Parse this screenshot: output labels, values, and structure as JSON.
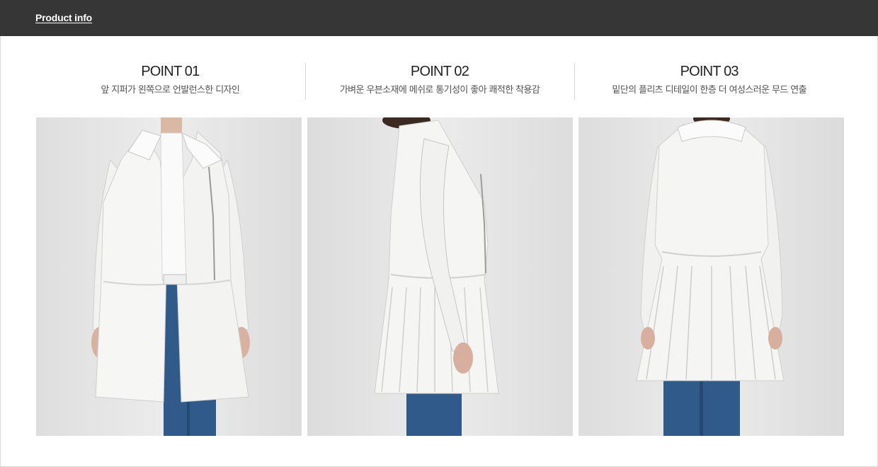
{
  "header": {
    "title": "Product info"
  },
  "points": [
    {
      "title": "POINT 01",
      "description": "앞 지퍼가 왼쪽으로 언발런스한 디자인"
    },
    {
      "title": "POINT 02",
      "description": "가벼운 우븐소재에 메쉬로 통기성이 좋아 쾌적한 착용감"
    },
    {
      "title": "POINT 03",
      "description": "밑단의 플리츠 디테일이 한층 더 여성스러운 무드 연출"
    }
  ],
  "photos": [
    {
      "view": "front"
    },
    {
      "view": "side"
    },
    {
      "view": "back"
    }
  ],
  "colors": {
    "header_bg": "#363636",
    "garment": "#f4f4f2",
    "jeans": "#2f5a8a",
    "photo_bg": "#e4e4e4"
  }
}
